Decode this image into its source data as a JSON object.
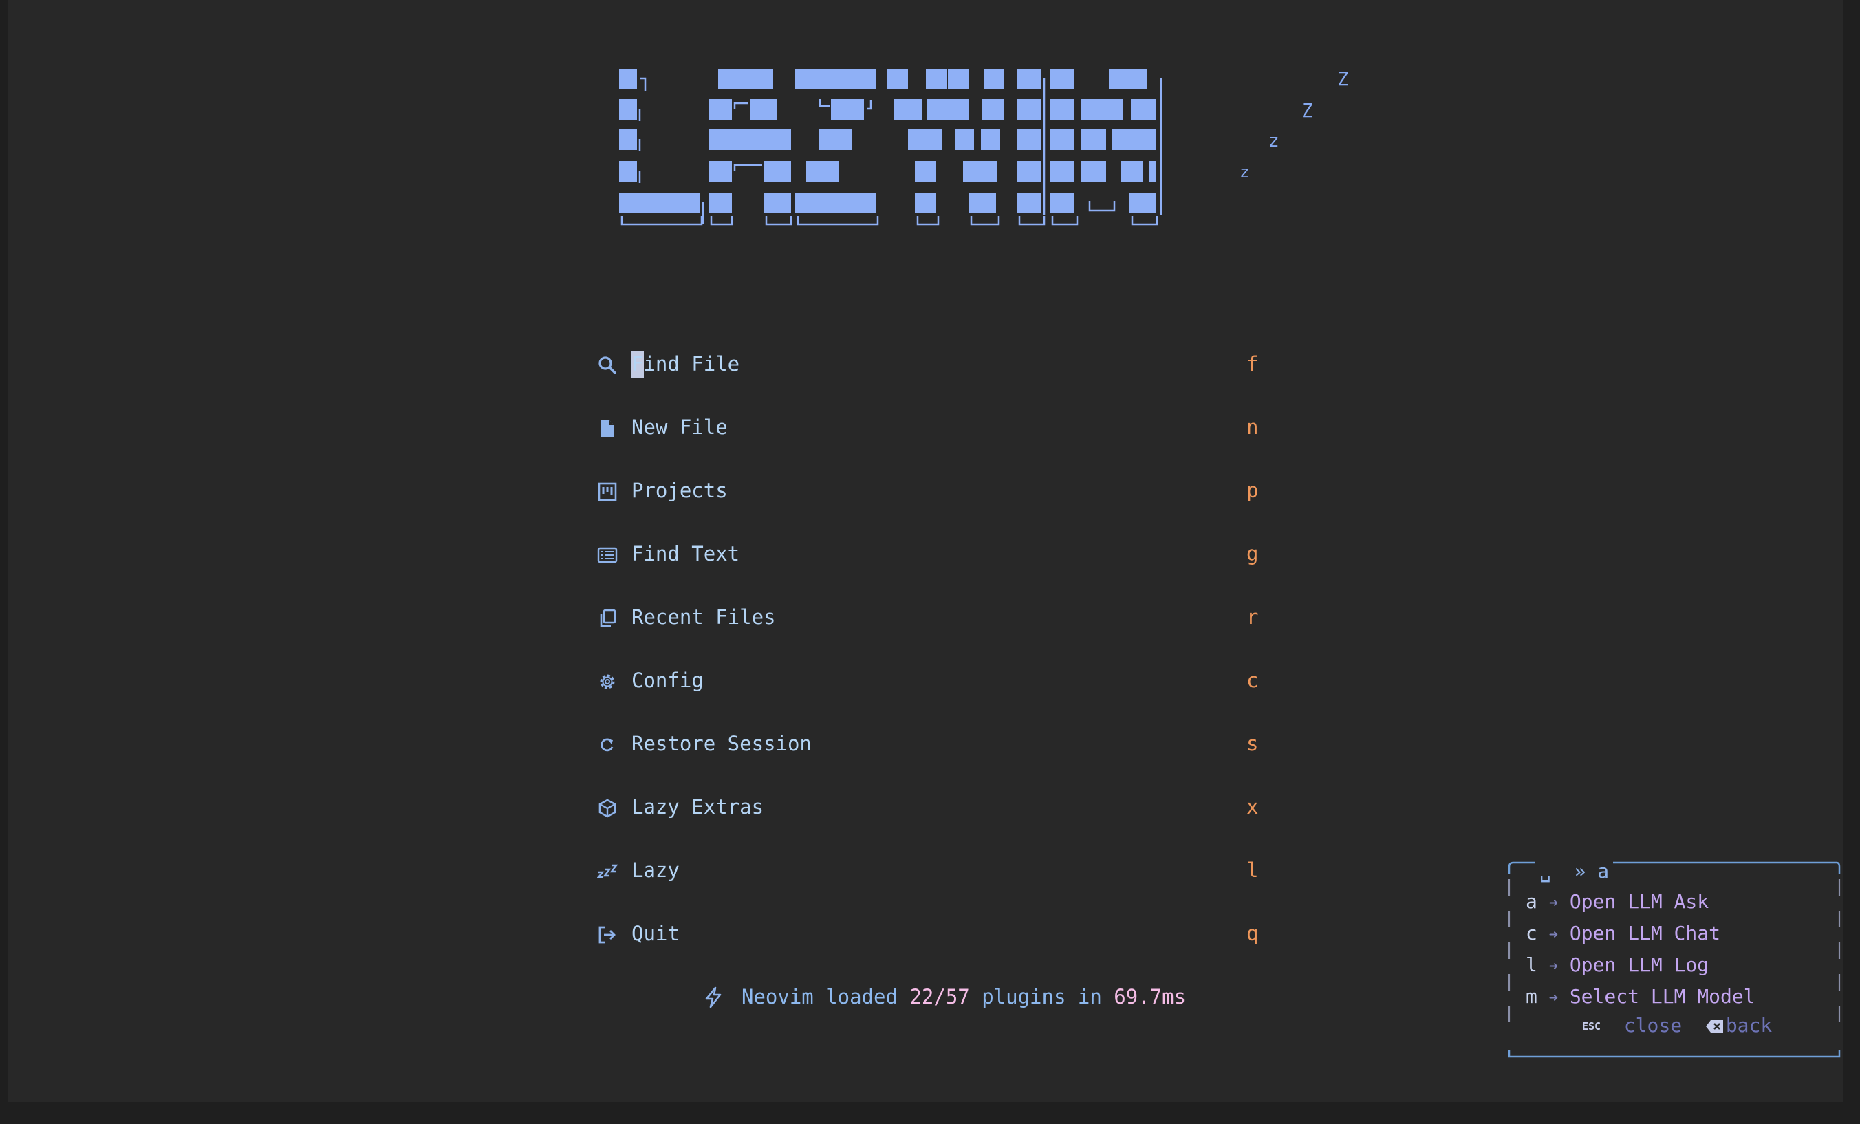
{
  "logo": {
    "text": "LazyVim",
    "sleep_marks": [
      "Z",
      "Z",
      "z",
      "z"
    ]
  },
  "menu": [
    {
      "icon": "search-icon",
      "label": "Find File",
      "key": "f"
    },
    {
      "icon": "file-icon",
      "label": "New File",
      "key": "n"
    },
    {
      "icon": "projects-icon",
      "label": "Projects",
      "key": "p"
    },
    {
      "icon": "find-text-icon",
      "label": "Find Text",
      "key": "g"
    },
    {
      "icon": "recent-files-icon",
      "label": "Recent Files",
      "key": "r"
    },
    {
      "icon": "gear-icon",
      "label": "Config",
      "key": "c"
    },
    {
      "icon": "restore-icon",
      "label": "Restore Session",
      "key": "s"
    },
    {
      "icon": "cube-icon",
      "label": "Lazy Extras",
      "key": "x"
    },
    {
      "icon": "sleep-icon",
      "label": "Lazy",
      "key": "l"
    },
    {
      "icon": "quit-icon",
      "label": "Quit",
      "key": "q"
    }
  ],
  "footer": {
    "icon": "bolt-icon",
    "prefix": "Neovim loaded ",
    "plugins": "22/57",
    "middle": " plugins in ",
    "time": "69.7ms"
  },
  "whichkey": {
    "title": "␣  » a",
    "items": [
      {
        "key": "a",
        "arrow": "➜",
        "desc": "Open LLM Ask"
      },
      {
        "key": "c",
        "arrow": "➜",
        "desc": "Open LLM Chat"
      },
      {
        "key": "l",
        "arrow": "➜",
        "desc": "Open LLM Log"
      },
      {
        "key": "m",
        "arrow": "➜",
        "desc": "Select LLM Model"
      }
    ],
    "esc_label": "ESC",
    "close_label": "close",
    "back_label": "back"
  },
  "colors": {
    "background": "#282828",
    "logo": "#8fb0f6",
    "menu_text": "#b4d4f4",
    "menu_key": "#ee965a",
    "footer_highlight": "#f5bde6",
    "whichkey_desc": "#c3a6f0"
  }
}
